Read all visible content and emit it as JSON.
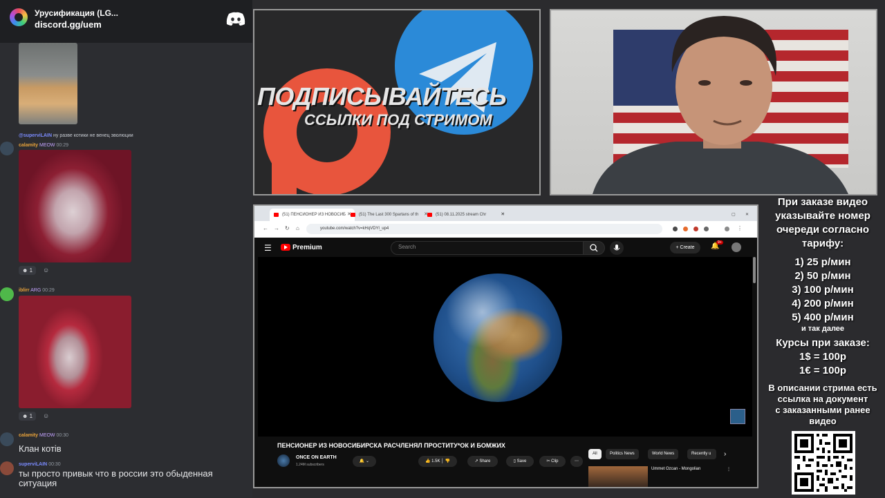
{
  "discord": {
    "server_name": "Урусификация (LG...",
    "server_link": "discord.gg/uem",
    "messages": [
      {
        "user": "@superviLAIN",
        "text": "ну разве котики не венец эволюции"
      },
      {
        "user": "calamity",
        "tag": "MEOW",
        "time": "00:29"
      },
      {
        "user": "iblirr",
        "tag": "ARG",
        "time": "00:29"
      },
      {
        "user": "calamity",
        "tag": "MEOW",
        "time": "00:30",
        "text": "Клан котів"
      },
      {
        "user": "superviLAIN",
        "time": "00:30",
        "text": "ты просто привык что в россии это обыденная ситуация"
      }
    ],
    "reactions": [
      {
        "count": "1"
      },
      {
        "count": "1"
      }
    ]
  },
  "promo": {
    "title": "ПОДПИСЫВАЙТЕСЬ",
    "subtitle": "ССЫЛКИ ПОД СТРИМОМ",
    "colors": {
      "patreon": "#e8553d",
      "telegram": "#2b8ad8"
    }
  },
  "browser": {
    "tabs": [
      {
        "label": "(51) ПЕНСИОНЕР ИЗ НОВОСИБ",
        "active": true
      },
      {
        "label": "(51) The Last 300 Spartans of th",
        "active": false
      },
      {
        "label": "(51) 08.11.2025 stream Chr",
        "active": false
      }
    ],
    "url": "youtube.com/watch?v=kHqVDYl_up4",
    "youtube": {
      "brand": "Premium",
      "search_placeholder": "Search",
      "create_label": "Create",
      "notif_badge": "9+",
      "video_title": "ПЕНСИОНЕР ИЗ НОВОСИБИРСКА РАСЧЛЕНЯЛ ПРОСТИТУ*ОК И БОМЖИХ",
      "channel_name": "ONCE ON EARTH",
      "subscribers": "1.24M subscribers",
      "likes": "1.5K",
      "share_label": "Share",
      "save_label": "Save",
      "clip_label": "Clip",
      "chips": [
        "All",
        "Politics News",
        "World News",
        "Recently u"
      ],
      "related_title": "Ummet Ozcan - Mongolian"
    }
  },
  "info": {
    "intro": [
      "При заказе видео",
      "указывайте номер",
      "очереди согласно",
      "тарифу:"
    ],
    "tariffs": [
      "1) 25 р/мин",
      "2) 50 р/мин",
      "3) 100 р/мин",
      "4) 200 р/мин",
      "5) 400 р/мин"
    ],
    "etc": "и так далее",
    "rates_title": "Курсы при заказе:",
    "rates": [
      "1$ = 100р",
      "1€ = 100р"
    ],
    "note": [
      "В описании стрима есть",
      "ссылка на документ",
      "с заказанными ранее",
      "видео"
    ]
  }
}
